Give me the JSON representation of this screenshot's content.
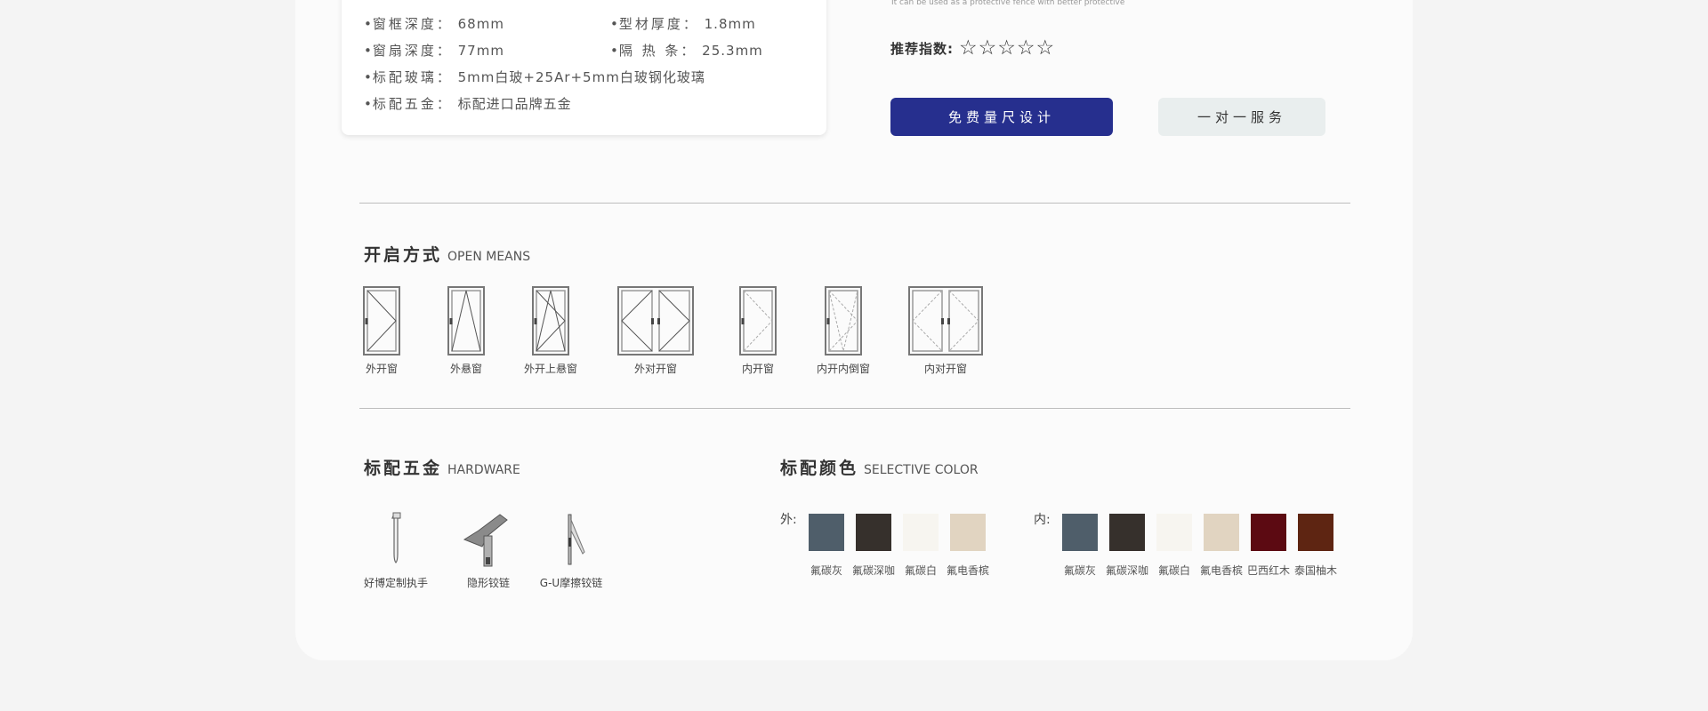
{
  "specs": [
    {
      "label": "窗框深度：",
      "value": "68mm"
    },
    {
      "label": "型材厚度：",
      "value": "1.8mm"
    },
    {
      "label": "窗扇深度：",
      "value": "77mm"
    },
    {
      "label": "隔 热 条：",
      "value": "25.3mm"
    },
    {
      "label": "标配玻璃：",
      "value": "5mm白玻+25Ar+5mm白玻钢化玻璃"
    },
    {
      "label": "标配五金：",
      "value": "标配进口品牌五金"
    }
  ],
  "bullet": "•",
  "tiny_note": "It can be used as a protective fence with better protective",
  "recommend": {
    "label": "推荐指数:",
    "stars": 5,
    "star_char": "☆"
  },
  "buttons": {
    "primary": "免费量尺设计",
    "secondary": "一对一服务"
  },
  "open_means": {
    "title": "开启方式",
    "subtitle": "OPEN MEANS",
    "items": [
      {
        "label": "外开窗",
        "icon": "outward-casement-window-icon"
      },
      {
        "label": "外悬窗",
        "icon": "outward-awning-window-icon"
      },
      {
        "label": "外开上悬窗",
        "icon": "outward-tilt-top-window-icon"
      },
      {
        "label": "外对开窗",
        "icon": "outward-double-casement-window-icon"
      },
      {
        "label": "内开窗",
        "icon": "inward-casement-window-icon"
      },
      {
        "label": "内开内倒窗",
        "icon": "tilt-turn-window-icon"
      },
      {
        "label": "内对开窗",
        "icon": "inward-double-casement-window-icon"
      }
    ]
  },
  "hardware": {
    "title": "标配五金",
    "subtitle": "HARDWARE",
    "items": [
      {
        "label": "好博定制执手",
        "icon": "window-handle-icon"
      },
      {
        "label": "隐形铰链",
        "icon": "hidden-hinge-icon"
      },
      {
        "label": "G-U摩擦铰链",
        "icon": "friction-hinge-icon"
      }
    ]
  },
  "colors": {
    "title": "标配颜色",
    "subtitle": "SELECTIVE COLOR",
    "outer_label": "外:",
    "inner_label": "内:",
    "outer": [
      {
        "name": "氟碳灰",
        "hex": "#4f5e6a"
      },
      {
        "name": "氟碳深咖",
        "hex": "#36302c"
      },
      {
        "name": "氟碳白",
        "hex": "#f7f5f0"
      },
      {
        "name": "氟电香槟",
        "hex": "#e1d4c1"
      }
    ],
    "inner": [
      {
        "name": "氟碳灰",
        "hex": "#4f5e6a"
      },
      {
        "name": "氟碳深咖",
        "hex": "#36302c"
      },
      {
        "name": "氟碳白",
        "hex": "#f7f5f0"
      },
      {
        "name": "氟电香槟",
        "hex": "#e1d4c1"
      },
      {
        "name": "巴西红木",
        "hex": "#5c0a12"
      },
      {
        "name": "泰国柚木",
        "hex": "#5e2512"
      }
    ]
  }
}
